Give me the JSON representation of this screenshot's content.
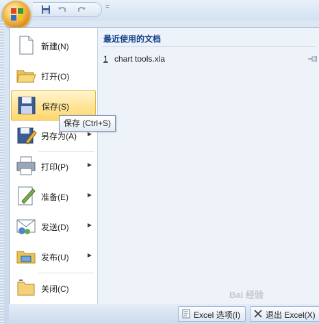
{
  "quick_access": {
    "icons": [
      "office-button-icon",
      "save-icon",
      "undo-icon",
      "redo-icon"
    ],
    "dropdown_glyph": "="
  },
  "menu": {
    "items": [
      {
        "label": "新建(N)",
        "icon": "new-document-icon",
        "has_submenu": false
      },
      {
        "label": "打开(O)",
        "icon": "open-folder-icon",
        "has_submenu": false
      },
      {
        "label": "保存(S)",
        "icon": "save-icon",
        "has_submenu": false,
        "highlighted": true
      },
      {
        "label": "另存为(A)",
        "icon": "save-as-icon",
        "has_submenu": true
      },
      {
        "label": "打印(P)",
        "icon": "printer-icon",
        "has_submenu": true
      },
      {
        "label": "准备(E)",
        "icon": "prepare-icon",
        "has_submenu": true
      },
      {
        "label": "发送(D)",
        "icon": "send-icon",
        "has_submenu": true
      },
      {
        "label": "发布(U)",
        "icon": "publish-icon",
        "has_submenu": true
      },
      {
        "label": "关闭(C)",
        "icon": "close-folder-icon",
        "has_submenu": false
      }
    ],
    "submenu_arrow": "▶"
  },
  "recent": {
    "title": "最近使用的文档",
    "items": [
      {
        "number": "1",
        "name": "chart tools.xla"
      }
    ]
  },
  "tooltip": {
    "text": "保存 (Ctrl+S)"
  },
  "bottom": {
    "options_label": "Excel 选项(I)",
    "exit_label": "退出 Excel(X)"
  },
  "watermark": "Bai 经验",
  "colors": {
    "accent_blue": "#15428b",
    "hover_gold": "#ffd66b",
    "panel_bg": "#eef3fa"
  }
}
